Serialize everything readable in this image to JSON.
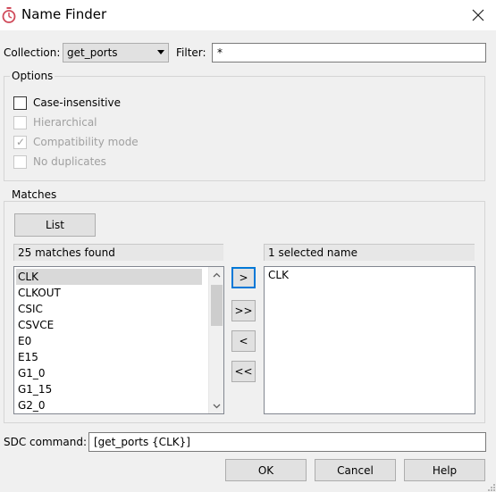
{
  "window": {
    "title": "Name Finder",
    "icon": "stopwatch-icon",
    "close_glyph": "✕"
  },
  "collection": {
    "label": "Collection:",
    "selected": "get_ports"
  },
  "filter": {
    "label": "Filter:",
    "value": "*"
  },
  "options": {
    "title": "Options",
    "case_insensitive": {
      "label": "Case-insensitive",
      "checked": false,
      "enabled": true
    },
    "hierarchical": {
      "label": "Hierarchical",
      "checked": false,
      "enabled": false
    },
    "compatibility_mode": {
      "label": "Compatibility mode",
      "checked": true,
      "enabled": false
    },
    "no_duplicates": {
      "label": "No duplicates",
      "checked": false,
      "enabled": false
    }
  },
  "matches": {
    "title": "Matches",
    "list_button": "List",
    "found_text": "25 matches found",
    "selected_text": "1 selected name",
    "items": [
      "CLK",
      "CLKOUT",
      "CSIC",
      "CSVCE",
      "E0",
      "E15",
      "G1_0",
      "G1_15",
      "G2_0"
    ],
    "selected_item": "CLK",
    "selected_names": [
      "CLK"
    ],
    "move_buttons": [
      ">",
      ">>",
      "<",
      "<<"
    ]
  },
  "sdc": {
    "label": "SDC command:",
    "value": "[get_ports {CLK}]"
  },
  "footer": {
    "ok": "OK",
    "cancel": "Cancel",
    "help": "Help"
  }
}
